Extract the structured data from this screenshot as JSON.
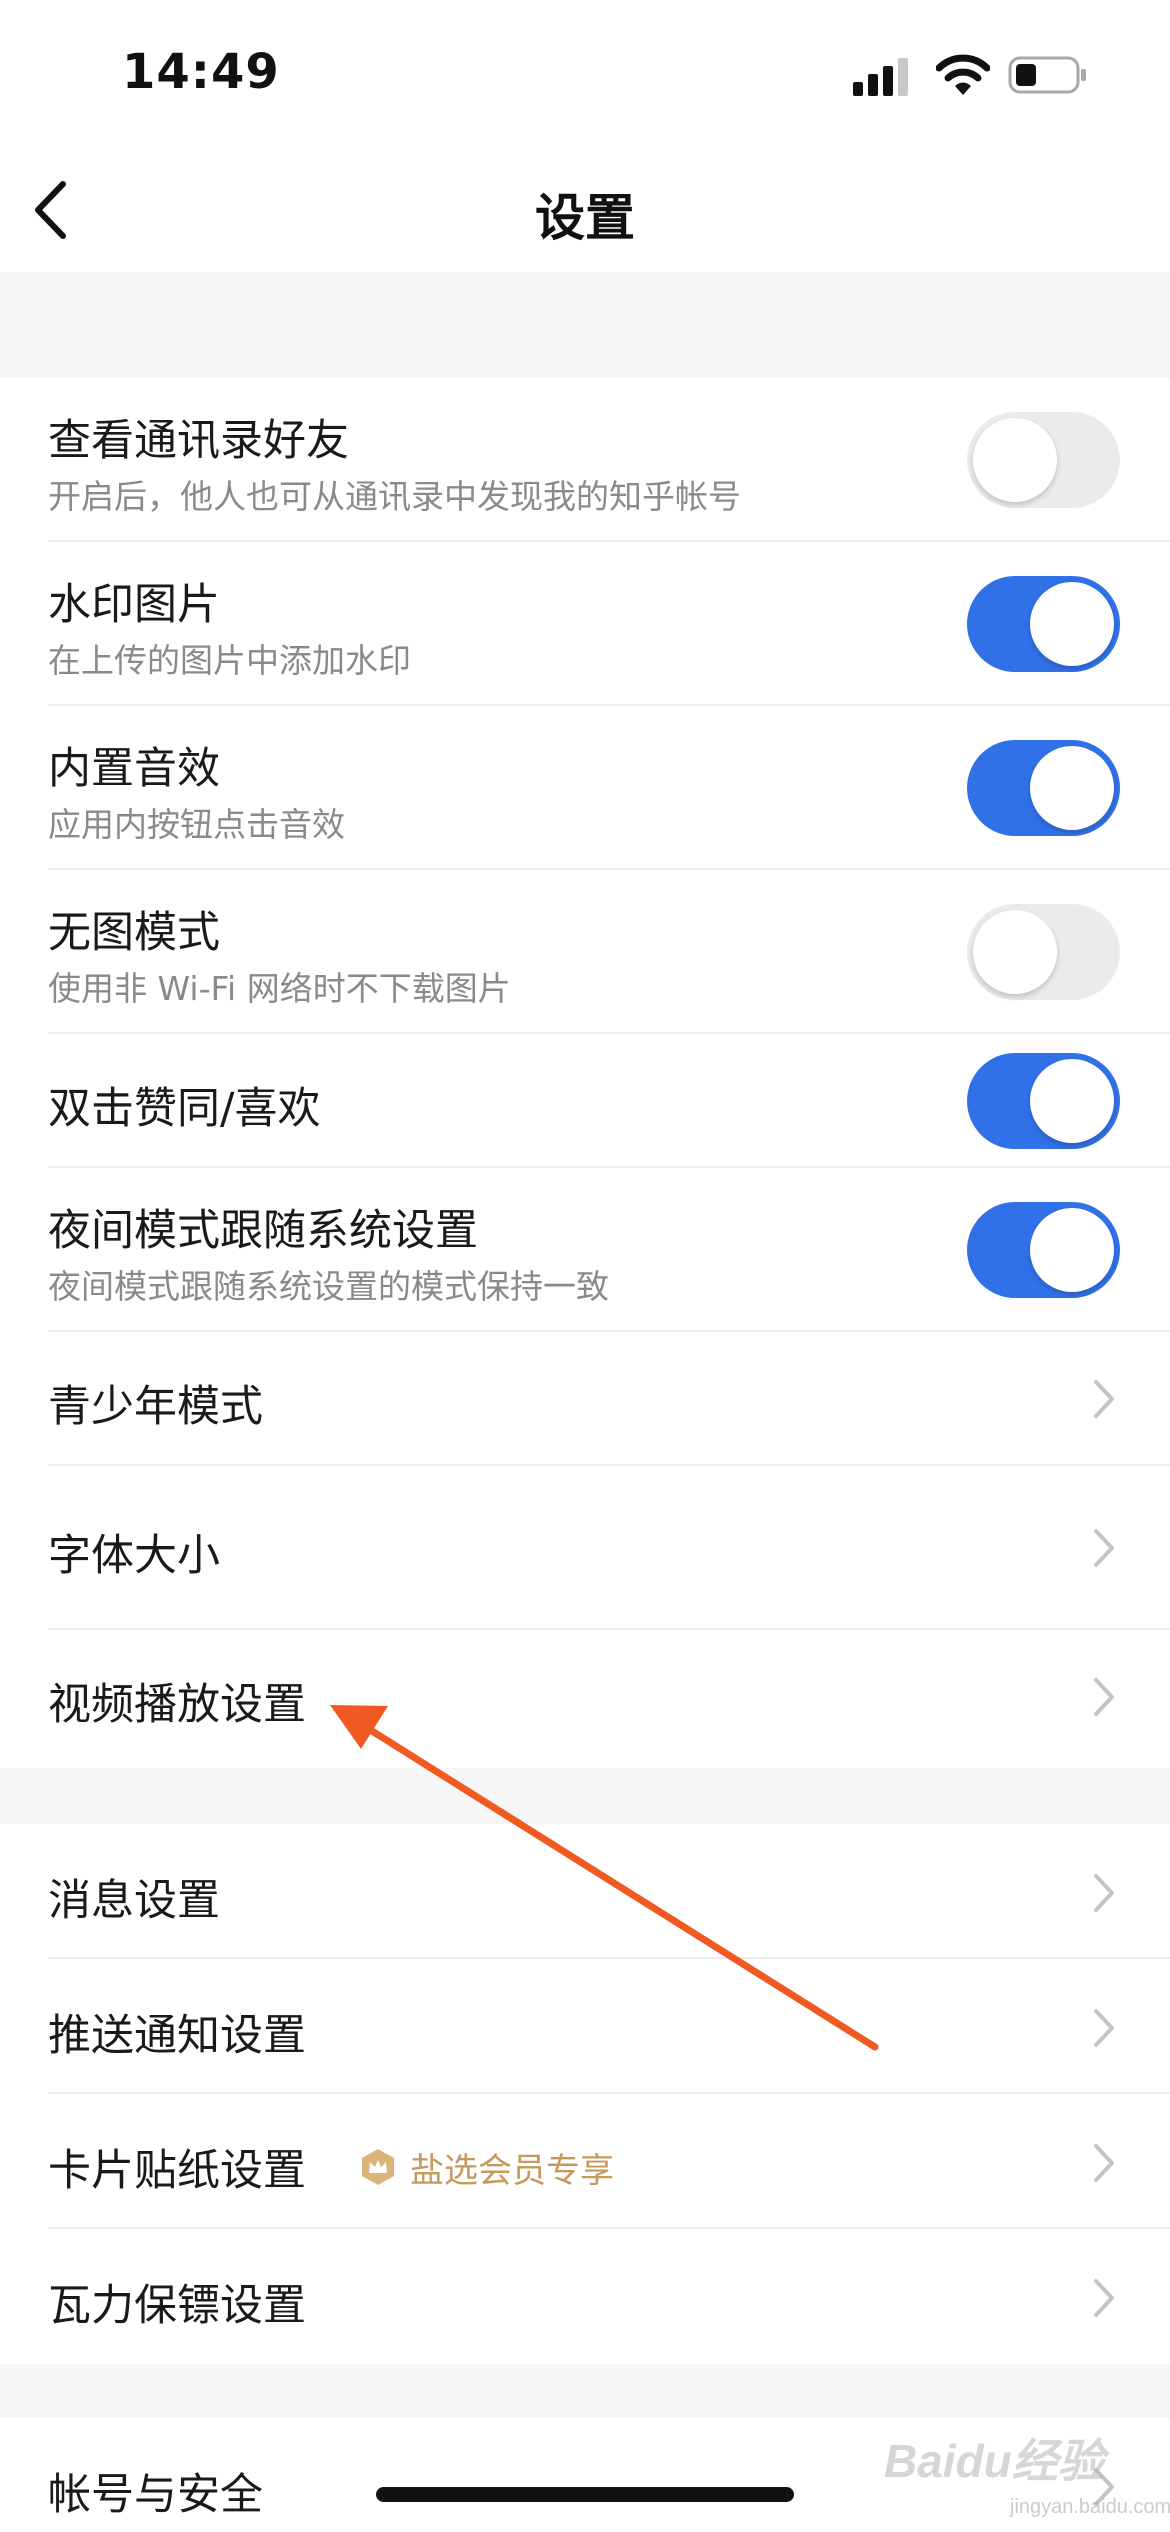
{
  "status_bar": {
    "time": "14:49",
    "signal_icon": "signal-icon",
    "wifi_icon": "wifi-icon",
    "battery_icon": "battery-icon"
  },
  "nav": {
    "title": "设置",
    "back_icon": "chevron-left-icon"
  },
  "settings": {
    "contacts": {
      "title": "查看通讯录好友",
      "subtitle": "开启后，他人也可从通讯录中发现我的知乎帐号",
      "enabled": false
    },
    "watermark": {
      "title": "水印图片",
      "subtitle": "在上传的图片中添加水印",
      "enabled": true
    },
    "sound": {
      "title": "内置音效",
      "subtitle": "应用内按钮点击音效",
      "enabled": true
    },
    "no_image": {
      "title": "无图模式",
      "subtitle": "使用非 Wi-Fi 网络时不下载图片",
      "enabled": false
    },
    "double_tap": {
      "title": "双击赞同/喜欢",
      "enabled": true
    },
    "night_mode": {
      "title": "夜间模式跟随系统设置",
      "subtitle": "夜间模式跟随系统设置的模式保持一致",
      "enabled": true
    },
    "teen_mode": {
      "title": "青少年模式"
    },
    "font_size": {
      "title": "字体大小"
    },
    "video_playback": {
      "title": "视频播放设置"
    },
    "message": {
      "title": "消息设置"
    },
    "push": {
      "title": "推送通知设置"
    },
    "card_sticker": {
      "title": "卡片贴纸设置",
      "badge": "盐选会员专享",
      "badge_icon": "vip-crown-icon"
    },
    "bodyguard": {
      "title": "瓦力保镖设置"
    },
    "account": {
      "title": "帐号与安全"
    }
  },
  "overlay": {
    "arrow_color": "#f05a22"
  },
  "watermark_overlay": {
    "logo": "Baidu经验",
    "url": "jingyan.baidu.com"
  },
  "colors": {
    "toggle_on": "#3171e8",
    "toggle_off": "#ebebeb",
    "badge": "#c49a5a"
  }
}
